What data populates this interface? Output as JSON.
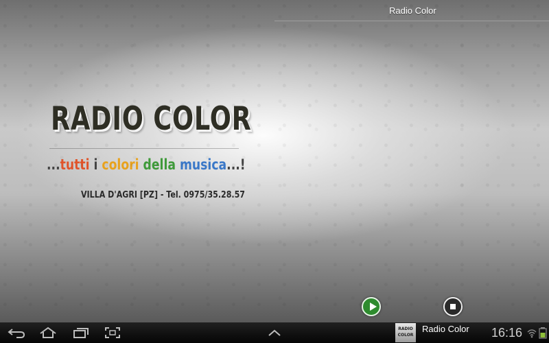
{
  "app": {
    "title": "Radio Color"
  },
  "logo": {
    "name": "RADIO COLOR",
    "slogan": [
      {
        "text": "...",
        "color": "#444444"
      },
      {
        "text": "tutti",
        "color": "#e0542a"
      },
      {
        "text": " i ",
        "color": "#444444"
      },
      {
        "text": "colori",
        "color": "#e8a21e"
      },
      {
        "text": " ",
        "color": "#444444"
      },
      {
        "text": "della",
        "color": "#3f9a3a"
      },
      {
        "text": " ",
        "color": "#444444"
      },
      {
        "text": "musica",
        "color": "#3a78c8"
      },
      {
        "text": "...!",
        "color": "#444444"
      }
    ],
    "address": "VILLA D'AGRI [PZ] - Tel. 0975/35.28.57"
  },
  "controls": {
    "play_icon": "play-icon",
    "stop_icon": "stop-icon",
    "play_color": "#2e8b2e"
  },
  "navbar": {
    "icons": [
      "back-icon",
      "home-icon",
      "recent-apps-icon",
      "screenshot-icon",
      "up-chevron-icon"
    ]
  },
  "notification": {
    "thumb_text": "RADIO COLOR",
    "title": "Radio Color"
  },
  "status": {
    "time": "16:16",
    "icons": [
      "wifi-icon",
      "battery-icon"
    ]
  }
}
